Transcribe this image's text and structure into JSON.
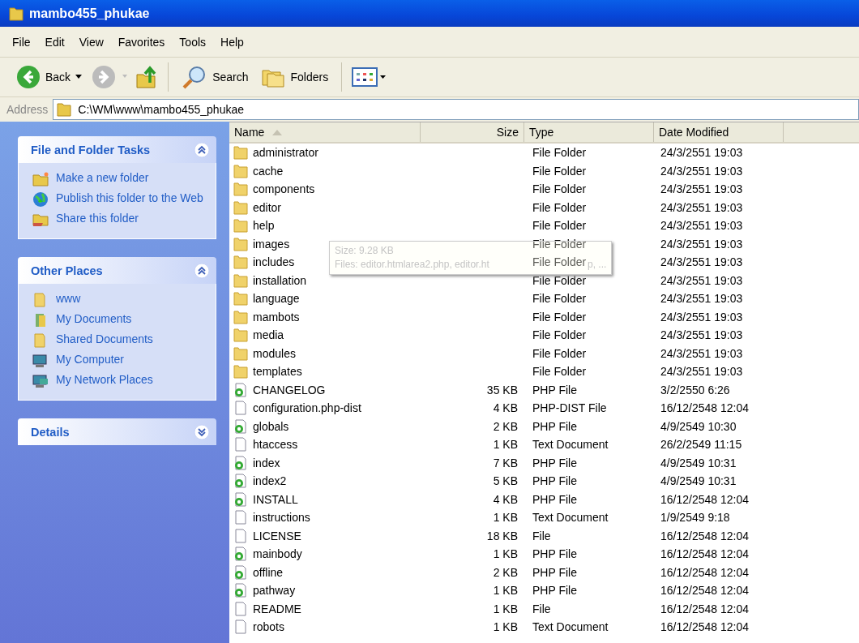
{
  "window": {
    "title": "mambo455_phukae"
  },
  "menu": [
    "File",
    "Edit",
    "View",
    "Favorites",
    "Tools",
    "Help"
  ],
  "toolbar": {
    "back": "Back",
    "search": "Search",
    "folders": "Folders"
  },
  "address": {
    "label": "Address",
    "value": "C:\\WM\\www\\mambo455_phukae"
  },
  "sidebar": [
    {
      "title": "File and Folder Tasks",
      "expanded": true,
      "items": [
        {
          "label": "Make a new folder",
          "kind": "newfolder"
        },
        {
          "label": "Publish this folder to the Web",
          "kind": "globe"
        },
        {
          "label": "Share this folder",
          "kind": "share"
        }
      ]
    },
    {
      "title": "Other Places",
      "expanded": true,
      "items": [
        {
          "label": "www",
          "kind": "folder"
        },
        {
          "label": "My Documents",
          "kind": "docs"
        },
        {
          "label": "Shared Documents",
          "kind": "folder"
        },
        {
          "label": "My Computer",
          "kind": "computer"
        },
        {
          "label": "My Network Places",
          "kind": "network"
        }
      ]
    },
    {
      "title": "Details",
      "expanded": false
    }
  ],
  "table": {
    "columns": [
      "Name",
      "Size",
      "Type",
      "Date Modified"
    ],
    "rows": [
      {
        "kind": "folder",
        "name": "administrator",
        "size": "",
        "type": "File Folder",
        "date": "24/3/2551 19:03"
      },
      {
        "kind": "folder",
        "name": "cache",
        "size": "",
        "type": "File Folder",
        "date": "24/3/2551 19:03"
      },
      {
        "kind": "folder",
        "name": "components",
        "size": "",
        "type": "File Folder",
        "date": "24/3/2551 19:03"
      },
      {
        "kind": "folder",
        "name": "editor",
        "size": "",
        "type": "File Folder",
        "date": "24/3/2551 19:03"
      },
      {
        "kind": "folder",
        "name": "help",
        "size": "",
        "type": "File Folder",
        "date": "24/3/2551 19:03"
      },
      {
        "kind": "folder",
        "name": "images",
        "size": "",
        "type": "File Folder",
        "date": "24/3/2551 19:03"
      },
      {
        "kind": "folder",
        "name": "includes",
        "size": "",
        "type": "File Folder",
        "date": "24/3/2551 19:03"
      },
      {
        "kind": "folder",
        "name": "installation",
        "size": "",
        "type": "File Folder",
        "date": "24/3/2551 19:03"
      },
      {
        "kind": "folder",
        "name": "language",
        "size": "",
        "type": "File Folder",
        "date": "24/3/2551 19:03"
      },
      {
        "kind": "folder",
        "name": "mambots",
        "size": "",
        "type": "File Folder",
        "date": "24/3/2551 19:03"
      },
      {
        "kind": "folder",
        "name": "media",
        "size": "",
        "type": "File Folder",
        "date": "24/3/2551 19:03"
      },
      {
        "kind": "folder",
        "name": "modules",
        "size": "",
        "type": "File Folder",
        "date": "24/3/2551 19:03"
      },
      {
        "kind": "folder",
        "name": "templates",
        "size": "",
        "type": "File Folder",
        "date": "24/3/2551 19:03"
      },
      {
        "kind": "php",
        "name": "CHANGELOG",
        "size": "35 KB",
        "type": "PHP File",
        "date": "3/2/2550 6:26"
      },
      {
        "kind": "file",
        "name": "configuration.php-dist",
        "size": "4 KB",
        "type": "PHP-DIST File",
        "date": "16/12/2548 12:04"
      },
      {
        "kind": "php",
        "name": "globals",
        "size": "2 KB",
        "type": "PHP File",
        "date": "4/9/2549 10:30"
      },
      {
        "kind": "file",
        "name": "htaccess",
        "size": "1 KB",
        "type": "Text Document",
        "date": "26/2/2549 11:15"
      },
      {
        "kind": "php",
        "name": "index",
        "size": "7 KB",
        "type": "PHP File",
        "date": "4/9/2549 10:31"
      },
      {
        "kind": "php",
        "name": "index2",
        "size": "5 KB",
        "type": "PHP File",
        "date": "4/9/2549 10:31"
      },
      {
        "kind": "php",
        "name": "INSTALL",
        "size": "4 KB",
        "type": "PHP File",
        "date": "16/12/2548 12:04"
      },
      {
        "kind": "file",
        "name": "instructions",
        "size": "1 KB",
        "type": "Text Document",
        "date": "1/9/2549 9:18"
      },
      {
        "kind": "file",
        "name": "LICENSE",
        "size": "18 KB",
        "type": "File",
        "date": "16/12/2548 12:04"
      },
      {
        "kind": "php",
        "name": "mainbody",
        "size": "1 KB",
        "type": "PHP File",
        "date": "16/12/2548 12:04"
      },
      {
        "kind": "php",
        "name": "offline",
        "size": "2 KB",
        "type": "PHP File",
        "date": "16/12/2548 12:04"
      },
      {
        "kind": "php",
        "name": "pathway",
        "size": "1 KB",
        "type": "PHP File",
        "date": "16/12/2548 12:04"
      },
      {
        "kind": "file",
        "name": "README",
        "size": "1 KB",
        "type": "File",
        "date": "16/12/2548 12:04"
      },
      {
        "kind": "file",
        "name": "robots",
        "size": "1 KB",
        "type": "Text Document",
        "date": "16/12/2548 12:04"
      }
    ]
  },
  "tooltip": {
    "size": "Size: 9.28 KB",
    "files": "Files: editor.htmlarea2.php, editor.ht",
    "files_end": "p, ..."
  }
}
